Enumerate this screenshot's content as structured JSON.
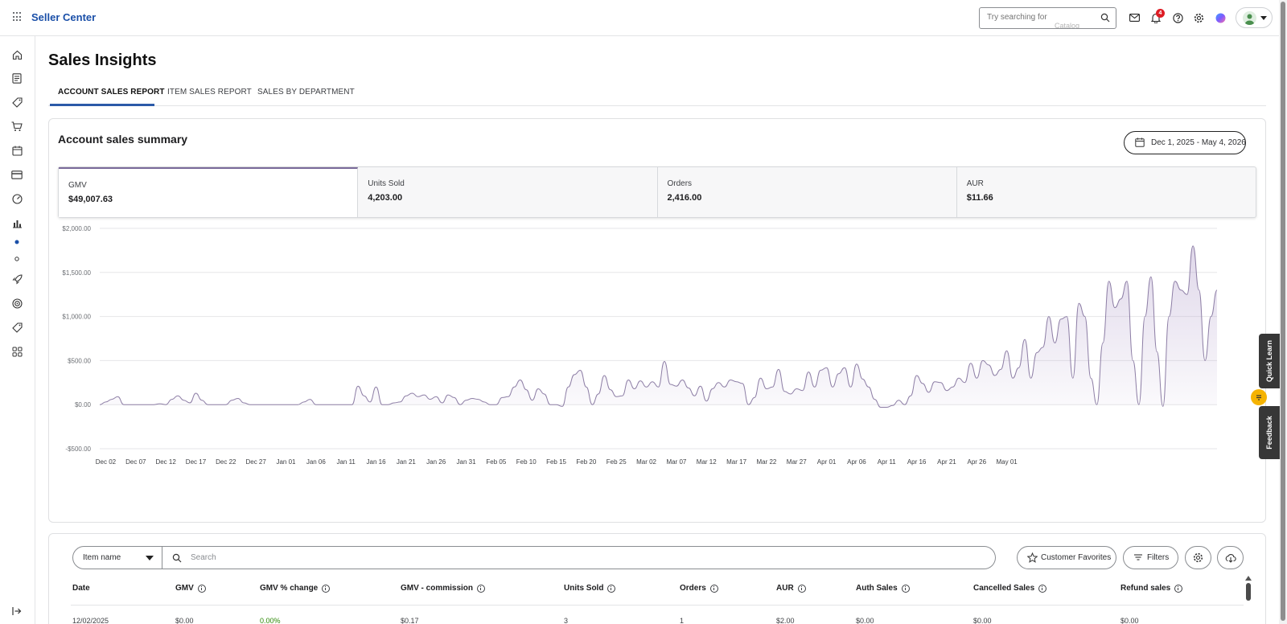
{
  "app": {
    "brand": "Seller Center"
  },
  "topbar": {
    "search_placeholder": "Try searching for",
    "search_suggestion": "Catalog",
    "notification_count": "4"
  },
  "page": {
    "title": "Sales Insights",
    "tabs": [
      {
        "label": "ACCOUNT SALES REPORT",
        "active": true
      },
      {
        "label": "ITEM SALES REPORT",
        "active": false
      },
      {
        "label": "SALES BY DEPARTMENT",
        "active": false
      }
    ]
  },
  "summary": {
    "title": "Account sales summary",
    "date_range": "Dec 1, 2025 - May 4, 2026",
    "metrics": [
      {
        "label": "GMV",
        "value": "$49,007.63"
      },
      {
        "label": "Units Sold",
        "value": "4,203.00"
      },
      {
        "label": "Orders",
        "value": "2,416.00"
      },
      {
        "label": "AUR",
        "value": "$11.66"
      }
    ]
  },
  "chart_data": {
    "type": "area",
    "title": "",
    "xlabel": "",
    "ylabel": "",
    "ylim": [
      -500,
      2000
    ],
    "y_ticks": [
      "$2,000.00",
      "$1,500.00",
      "$1,000.00",
      "$500.00",
      "$0.00",
      "-$500.00"
    ],
    "y_tick_values": [
      2000,
      1500,
      1000,
      500,
      0,
      -500
    ],
    "x_ticks": [
      "Dec 02",
      "Dec 07",
      "Dec 12",
      "Dec 17",
      "Dec 22",
      "Dec 27",
      "Jan 01",
      "Jan 06",
      "Jan 11",
      "Jan 16",
      "Jan 21",
      "Jan 26",
      "Jan 31",
      "Feb 05",
      "Feb 10",
      "Feb 15",
      "Feb 20",
      "Feb 25",
      "Mar 02",
      "Mar 07",
      "Mar 12",
      "Mar 17",
      "Mar 22",
      "Mar 27",
      "Apr 01",
      "Apr 06",
      "Apr 11",
      "Apr 16",
      "Apr 21",
      "Apr 26",
      "May 01"
    ],
    "x_start": "Dec 01",
    "grid": true,
    "series": [
      {
        "color": "#8e7fa6",
        "values": [
          0,
          30,
          60,
          90,
          0,
          0,
          0,
          0,
          0,
          0,
          10,
          0,
          60,
          100,
          50,
          20,
          130,
          50,
          0,
          0,
          0,
          0,
          50,
          70,
          20,
          0,
          0,
          0,
          0,
          0,
          0,
          0,
          0,
          0,
          30,
          60,
          0,
          0,
          0,
          0,
          0,
          0,
          0,
          210,
          100,
          30,
          200,
          0,
          0,
          20,
          30,
          100,
          130,
          90,
          110,
          60,
          90,
          20,
          110,
          80,
          0,
          50,
          70,
          60,
          30,
          0,
          0,
          80,
          90,
          200,
          280,
          170,
          50,
          180,
          120,
          0,
          0,
          -20,
          200,
          340,
          390,
          200,
          0,
          120,
          330,
          170,
          90,
          100,
          280,
          180,
          270,
          200,
          260,
          200,
          490,
          230,
          210,
          280,
          190,
          100,
          210,
          40,
          180,
          250,
          200,
          280,
          260,
          240,
          0,
          80,
          300,
          180,
          200,
          400,
          150,
          120,
          180,
          160,
          370,
          200,
          390,
          420,
          200,
          350,
          420,
          200,
          460,
          290,
          200,
          60,
          -30,
          -30,
          -10,
          50,
          0,
          100,
          330,
          240,
          140,
          260,
          250,
          160,
          200,
          300,
          250,
          470,
          300,
          500,
          450,
          330,
          400,
          610,
          300,
          420,
          740,
          300,
          590,
          650,
          1000,
          700,
          970,
          1000,
          300,
          1150,
          1000,
          300,
          0,
          700,
          1400,
          1100,
          1200,
          1400,
          500,
          0,
          1000,
          1450,
          600,
          -20,
          1000,
          1400,
          1300,
          1250,
          1800,
          1300,
          500,
          1000,
          1300
        ]
      }
    ]
  },
  "table": {
    "field_select": "Item name",
    "search_placeholder": "Search",
    "customer_favorites": "Customer Favorites",
    "filters": "Filters",
    "headers": [
      "Date",
      "GMV",
      "GMV % change",
      "GMV - commission",
      "Units Sold",
      "Orders",
      "AUR",
      "Auth Sales",
      "Cancelled Sales",
      "Refund sales"
    ],
    "first_row": [
      "12/02/2025",
      "$0.00",
      "0.00%",
      "$0.17",
      "3",
      "1",
      "$2.00",
      "$0.00",
      "$0.00",
      "$0.00"
    ]
  },
  "side_tabs": {
    "quick_learn": "Quick Learn",
    "feedback": "Feedback"
  }
}
